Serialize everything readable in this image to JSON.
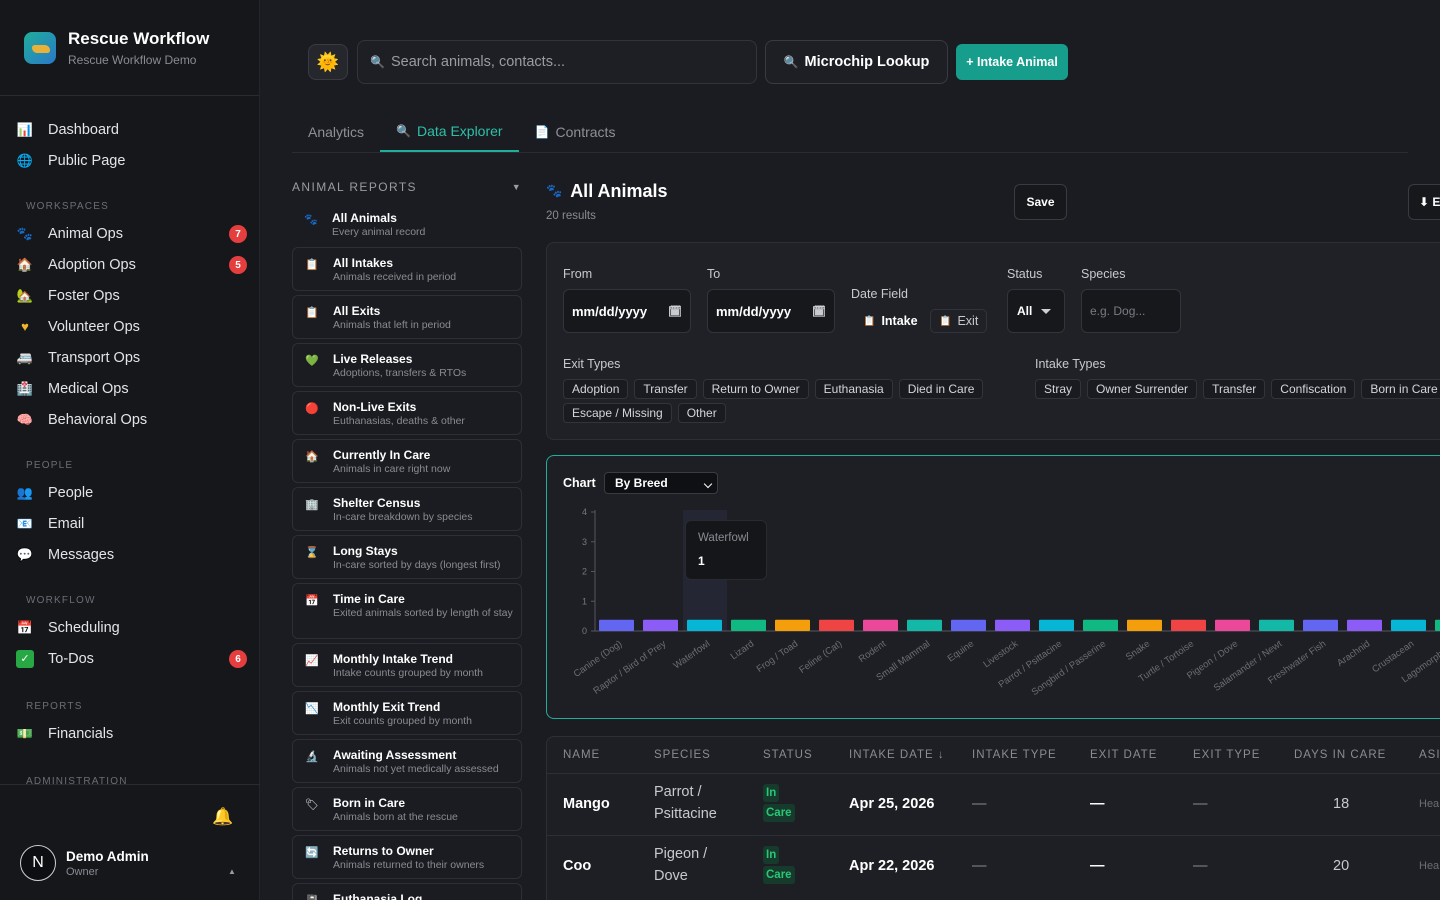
{
  "brand": {
    "title": "Rescue Workflow",
    "subtitle": "Rescue Workflow Demo"
  },
  "nav": {
    "top": [
      {
        "label": "Dashboard",
        "icon": "dashboard-icon"
      },
      {
        "label": "Public Page",
        "icon": "globe-icon"
      }
    ],
    "workspaces_label": "WORKSPACES",
    "workspaces": [
      {
        "label": "Animal Ops",
        "icon": "paw-icon",
        "badge": "7"
      },
      {
        "label": "Adoption Ops",
        "icon": "house-icon",
        "badge": "5"
      },
      {
        "label": "Foster Ops",
        "icon": "home-icon",
        "badge": ""
      },
      {
        "label": "Volunteer Ops",
        "icon": "heart-icon",
        "badge": ""
      },
      {
        "label": "Transport Ops",
        "icon": "truck-icon",
        "badge": ""
      },
      {
        "label": "Medical Ops",
        "icon": "medical-icon",
        "badge": ""
      },
      {
        "label": "Behavioral Ops",
        "icon": "brain-icon",
        "badge": ""
      }
    ],
    "people_label": "PEOPLE",
    "people": [
      {
        "label": "People",
        "icon": "people-icon"
      },
      {
        "label": "Email",
        "icon": "email-icon"
      },
      {
        "label": "Messages",
        "icon": "message-icon"
      }
    ],
    "workflow_label": "WORKFLOW",
    "workflow": [
      {
        "label": "Scheduling",
        "icon": "calendar-icon",
        "badge": ""
      },
      {
        "label": "To-Dos",
        "icon": "check-icon",
        "badge": "6"
      }
    ],
    "reports_label": "REPORTS",
    "reports": [
      {
        "label": "Financials",
        "icon": "money-icon"
      }
    ],
    "admin_label": "ADMINISTRATION"
  },
  "user": {
    "initial": "N",
    "name": "Demo Admin",
    "role": "Owner"
  },
  "topbar": {
    "search_placeholder": "Search animals, contacts...",
    "microchip": "Microchip Lookup",
    "intake": "+ Intake Animal"
  },
  "tabs": [
    {
      "label": "Analytics"
    },
    {
      "label": "Data Explorer",
      "icon": "🔍"
    },
    {
      "label": "Contracts",
      "icon": "📄"
    }
  ],
  "reports_panel": {
    "heading": "ANIMAL REPORTS",
    "items": [
      {
        "title": "All Animals",
        "desc": "Every animal record",
        "icon": "paw-icon"
      },
      {
        "title": "All Intakes",
        "desc": "Animals received in period",
        "icon": "clipboard-icon"
      },
      {
        "title": "All Exits",
        "desc": "Animals that left in period",
        "icon": "clipboard-icon"
      },
      {
        "title": "Live Releases",
        "desc": "Adoptions, transfers & RTOs",
        "icon": "heart-icon"
      },
      {
        "title": "Non-Live Exits",
        "desc": "Euthanasias, deaths & other",
        "icon": "red-circle-icon"
      },
      {
        "title": "Currently In Care",
        "desc": "Animals in care right now",
        "icon": "house-icon"
      },
      {
        "title": "Shelter Census",
        "desc": "In-care breakdown by species",
        "icon": "building-icon"
      },
      {
        "title": "Long Stays",
        "desc": "In-care sorted by days (longest first)",
        "icon": "hourglass-icon"
      },
      {
        "title": "Time in Care",
        "desc": "Exited animals sorted by length of stay",
        "icon": "calendar-icon"
      },
      {
        "title": "Monthly Intake Trend",
        "desc": "Intake counts grouped by month",
        "icon": "chart-up-icon"
      },
      {
        "title": "Monthly Exit Trend",
        "desc": "Exit counts grouped by month",
        "icon": "chart-down-icon"
      },
      {
        "title": "Awaiting Assessment",
        "desc": "Animals not yet medically assessed",
        "icon": "microscope-icon"
      },
      {
        "title": "Born in Care",
        "desc": "Animals born at the rescue",
        "icon": "tag-icon"
      },
      {
        "title": "Returns to Owner",
        "desc": "Animals returned to their owners",
        "icon": "return-icon"
      },
      {
        "title": "Euthanasia Log",
        "desc": "",
        "icon": "log-icon"
      }
    ]
  },
  "content": {
    "title": "All Animals",
    "results": "20 results",
    "save": "Save",
    "export": "⬇ E",
    "filters": {
      "from_label": "From",
      "to_label": "To",
      "date_placeholder": "mm/dd/yyyy",
      "date_field_label": "Date Field",
      "date_field_intake": "Intake",
      "date_field_exit": "Exit",
      "status_label": "Status",
      "status_value": "All",
      "species_label": "Species",
      "species_placeholder": "e.g. Dog...",
      "exit_types_label": "Exit Types",
      "exit_types": [
        "Adoption",
        "Transfer",
        "Return to Owner",
        "Euthanasia",
        "Died in Care",
        "Escape / Missing",
        "Other"
      ],
      "intake_types_label": "Intake Types",
      "intake_types": [
        "Stray",
        "Owner Surrender",
        "Transfer",
        "Confiscation",
        "Born in Care"
      ]
    },
    "chart_label": "Chart",
    "chart_select": "By Breed",
    "tooltip": {
      "label": "Waterfowl",
      "value": "1"
    }
  },
  "chart_data": {
    "type": "bar",
    "categories": [
      "Canine (Dog)",
      "Raptor / Bird of Prey",
      "Waterfowl",
      "Lizard",
      "Frog / Toad",
      "Feline (Cat)",
      "Rodent",
      "Small Mammal",
      "Equine",
      "Livestock",
      "Parrot / Psittacine",
      "Songbird / Passerine",
      "Snake",
      "Turtle / Tortoise",
      "Pigeon / Dove",
      "Salamander / Newt",
      "Freshwater Fish",
      "Arachnid",
      "Crustacean",
      "Lagomorph (Ra"
    ],
    "values": [
      1,
      1,
      1,
      1,
      1,
      1,
      1,
      1,
      1,
      1,
      1,
      1,
      1,
      1,
      1,
      1,
      1,
      1,
      1,
      1,
      1
    ],
    "colors": [
      "#6366f1",
      "#8b5cf6",
      "#06b6d4",
      "#10b981",
      "#f59e0b",
      "#ef4444",
      "#ec4899",
      "#14b8a6"
    ],
    "ylim": [
      0,
      4
    ],
    "yticks": [
      "0",
      "1",
      "2",
      "3",
      "4"
    ]
  },
  "table": {
    "headers": [
      "NAME",
      "SPECIES",
      "STATUS",
      "INTAKE DATE ↓",
      "INTAKE TYPE",
      "EXIT DATE",
      "EXIT TYPE",
      "DAYS IN CARE",
      "ASI"
    ],
    "rows": [
      {
        "name": "Mango",
        "species1": "Parrot /",
        "species2": "Psittacine",
        "status1": "In",
        "status2": "Care",
        "intake_date": "Apr 25, 2026",
        "intake_type": "—",
        "exit_date": "—",
        "exit_type": "—",
        "days": "18",
        "extra": "Hea"
      },
      {
        "name": "Coo",
        "species1": "Pigeon /",
        "species2": "Dove",
        "status1": "In",
        "status2": "Care",
        "intake_date": "Apr 22, 2026",
        "intake_type": "—",
        "exit_date": "—",
        "exit_type": "—",
        "days": "20",
        "extra": "Hea"
      }
    ]
  }
}
